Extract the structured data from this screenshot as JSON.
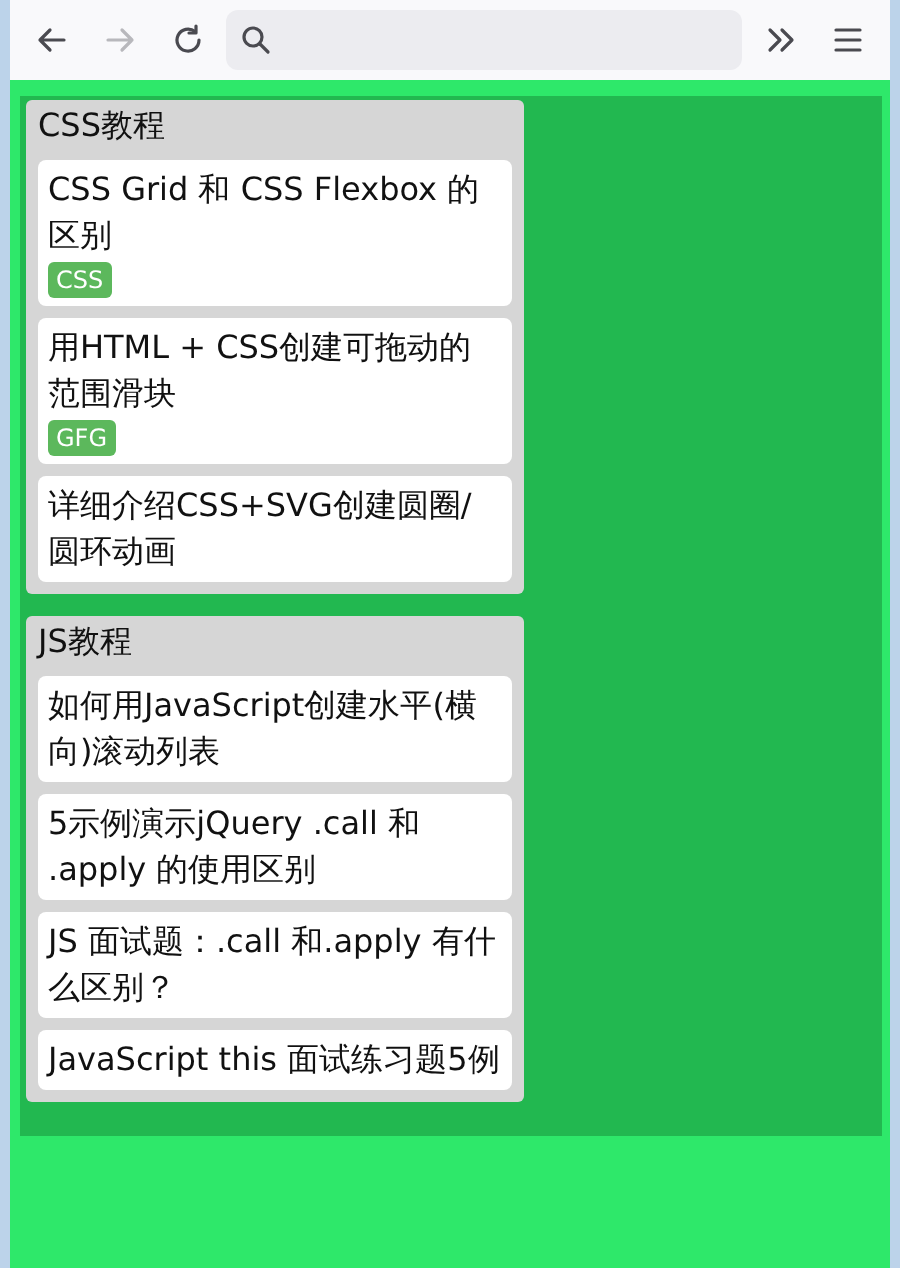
{
  "toolbar": {
    "forward_disabled": true
  },
  "lists": [
    {
      "title": "CSS教程",
      "cards": [
        {
          "text": "CSS Grid 和 CSS Flexbox 的区别",
          "tag": "CSS"
        },
        {
          "text": "用HTML + CSS创建可拖动的范围滑块",
          "tag": "GFG"
        },
        {
          "text": "详细介绍CSS+SVG创建圆圈/圆环动画"
        }
      ]
    },
    {
      "title": "JS教程",
      "cards": [
        {
          "text": "如何用JavaScript创建水平(横向)滚动列表"
        },
        {
          "text": "5示例演示jQuery .call 和 .apply 的使用区别"
        },
        {
          "text": "JS 面试题：.call 和.apply 有什么区别？"
        },
        {
          "text": "JavaScript this 面试练习题5例"
        }
      ]
    }
  ]
}
